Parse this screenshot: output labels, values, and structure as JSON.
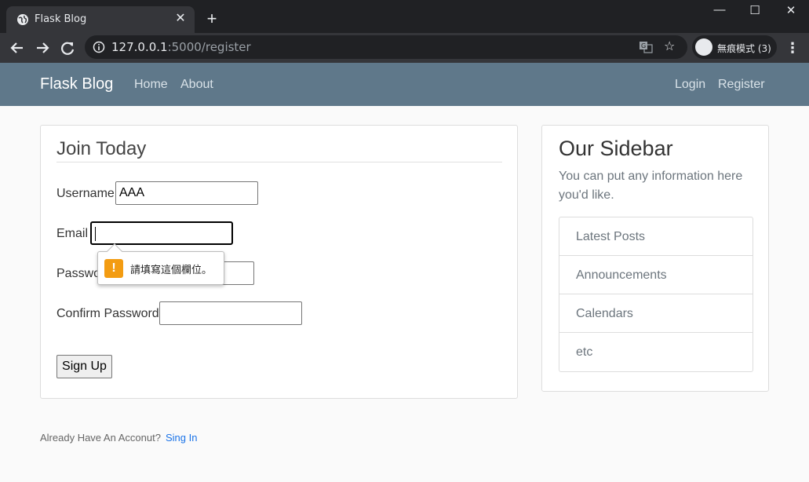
{
  "browser": {
    "tab_title": "Flask Blog",
    "tab_close": "✕",
    "new_tab": "+",
    "url_host": "127.0.0.1",
    "url_rest": ":5000/register",
    "incognito_label": "無痕模式 (3)",
    "window_min": "—",
    "window_max": "☐",
    "window_close": "✕",
    "menu": "⋮",
    "star": "☆"
  },
  "navbar": {
    "brand": "Flask Blog",
    "left_links": [
      "Home",
      "About"
    ],
    "right_links": [
      "Login",
      "Register"
    ]
  },
  "form": {
    "legend": "Join Today",
    "username_label": "Username",
    "username_value": "AAA",
    "email_label": "Email",
    "email_value": "",
    "password_label": "Password",
    "confirm_label": "Confirm Password",
    "submit_label": "Sign Up",
    "validation_message": "請填寫這個欄位。"
  },
  "sidebar": {
    "title": "Our Sidebar",
    "text": "You can put any information here you'd like.",
    "items": [
      "Latest Posts",
      "Announcements",
      "Calendars",
      "etc"
    ]
  },
  "footer": {
    "text": "Already Have An Acconut?",
    "link": "Sing In"
  }
}
